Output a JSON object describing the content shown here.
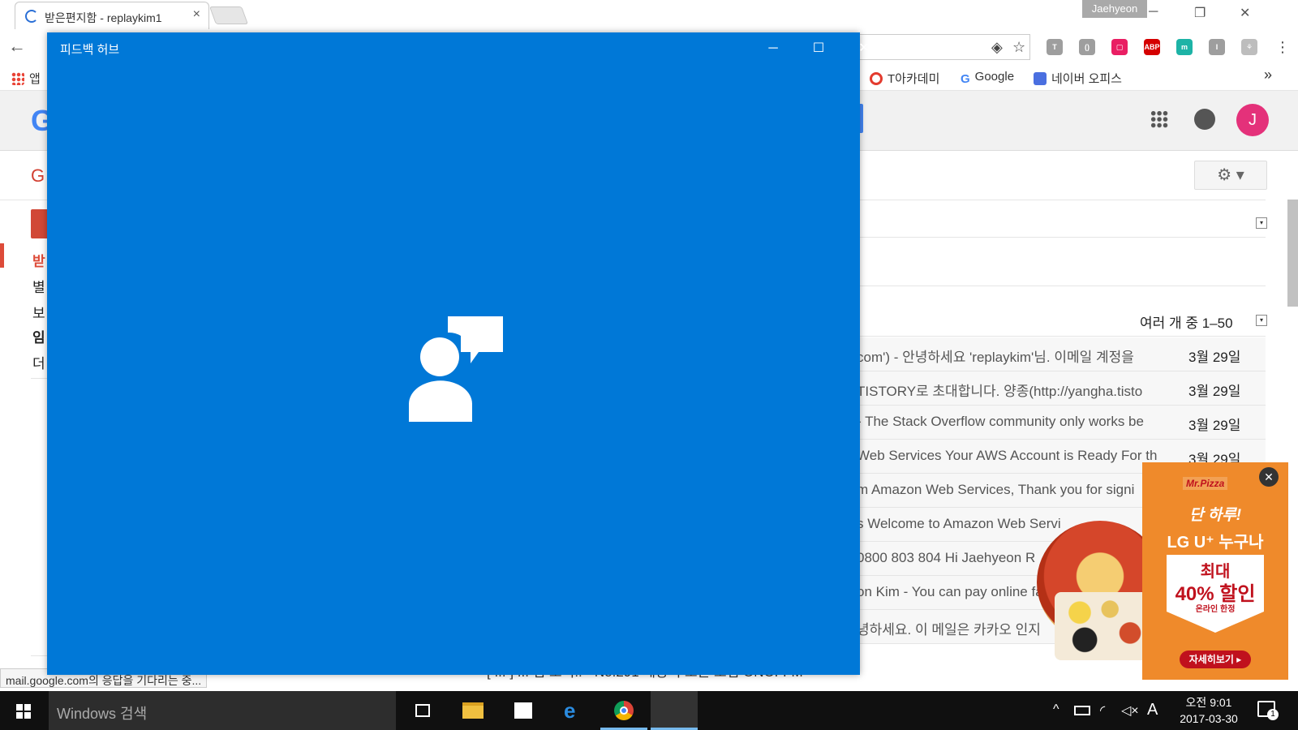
{
  "browser": {
    "tab_title": "받은편지함 - replaykim1",
    "tab_close": "×",
    "profile_name": "Jaehyeon",
    "minimize": "─",
    "restore": "❐",
    "close": "✕",
    "back": "←",
    "omnibox_star": "☆",
    "omnibox_key": "◈",
    "menu": "⋮",
    "extensions": [
      {
        "name": "T",
        "color": "#9e9e9e"
      },
      {
        "name": "()",
        "color": "#9e9e9e"
      },
      {
        "name": "▢",
        "color": "#e91e63"
      },
      {
        "name": "ABP",
        "color": "#d50000"
      },
      {
        "name": "m",
        "color": "#1db3a6"
      },
      {
        "name": "I",
        "color": "#9e9e9e"
      },
      {
        "name": "⚘",
        "color": "#bdbdbd"
      }
    ],
    "bookmarks": [
      {
        "label": "앱",
        "icon": "apps-grid-icon"
      },
      {
        "label": "T아카데미",
        "icon": "tacademy-icon"
      },
      {
        "label": "Google",
        "icon": "google-g-icon"
      },
      {
        "label": "네이버 오피스",
        "icon": "naver-office-icon"
      }
    ],
    "bookmarks_more": "»",
    "status_bar": "mail.google.com의 응답을 기다리는 중..."
  },
  "gmail": {
    "logo_letter": "G",
    "app_label": "G",
    "nav": [
      "받",
      "별",
      "보",
      "임",
      "더"
    ],
    "inbox_count": "여러 개 중 1–50",
    "dropdown": "▾",
    "notice_fragment": ".",
    "avatar_initial": "J",
    "settings": "⚙ ▾",
    "rows": [
      {
        "snippet": "com') - 안녕하세요 'replaykim'님. 이메일 계정을",
        "date": "3월 29일"
      },
      {
        "snippet": "TISTORY로 초대합니다. 양종(http://yangha.tisto",
        "date": "3월 29일"
      },
      {
        "snippet": "- The Stack Overflow community only works be",
        "date": "3월 29일"
      },
      {
        "snippet": "Web Services Your AWS Account is Ready For th",
        "date": "3월 29일"
      },
      {
        "snippet": "m Amazon Web Services, Thank you for signi",
        "date": ""
      },
      {
        "snippet": "s Welcome to Amazon Web Servi",
        "date": ""
      },
      {
        "snippet": "0800 803 804 Hi Jaehyeon R",
        "date": ""
      },
      {
        "snippet": "on Kim - You can pay online fast",
        "date": ""
      },
      {
        "snippet": "녕하세요. 이 메일은 카카오 인지",
        "date": ""
      }
    ],
    "last_row": "[ ... ] ... 임 소식!! - No.291 세상의 모든 모임 ONOFFM"
  },
  "ad": {
    "brand": "Mr.Pizza",
    "line1": "단 하루!",
    "line2": "LG U⁺ 누구나",
    "line3": "최대",
    "line4": "40% 할인",
    "line5": "온라인 한정",
    "cta": "자세히보기 ▸",
    "close": "✕"
  },
  "feedback_hub": {
    "title": "피드백 허브",
    "minimize": "─",
    "maximize": "☐",
    "close": "✕",
    "splash_icon": "person-feedback-icon",
    "background": "#0078d7"
  },
  "taskbar": {
    "search_placeholder": "Windows 검색",
    "apps": [
      "task-view-icon",
      "file-explorer-icon",
      "store-icon",
      "edge-icon",
      "chrome-icon",
      "feedback-hub-icon"
    ],
    "tray_chevron": "^",
    "ime": "A",
    "time": "오전 9:01",
    "date": "2017-03-30",
    "notifications": "1"
  }
}
